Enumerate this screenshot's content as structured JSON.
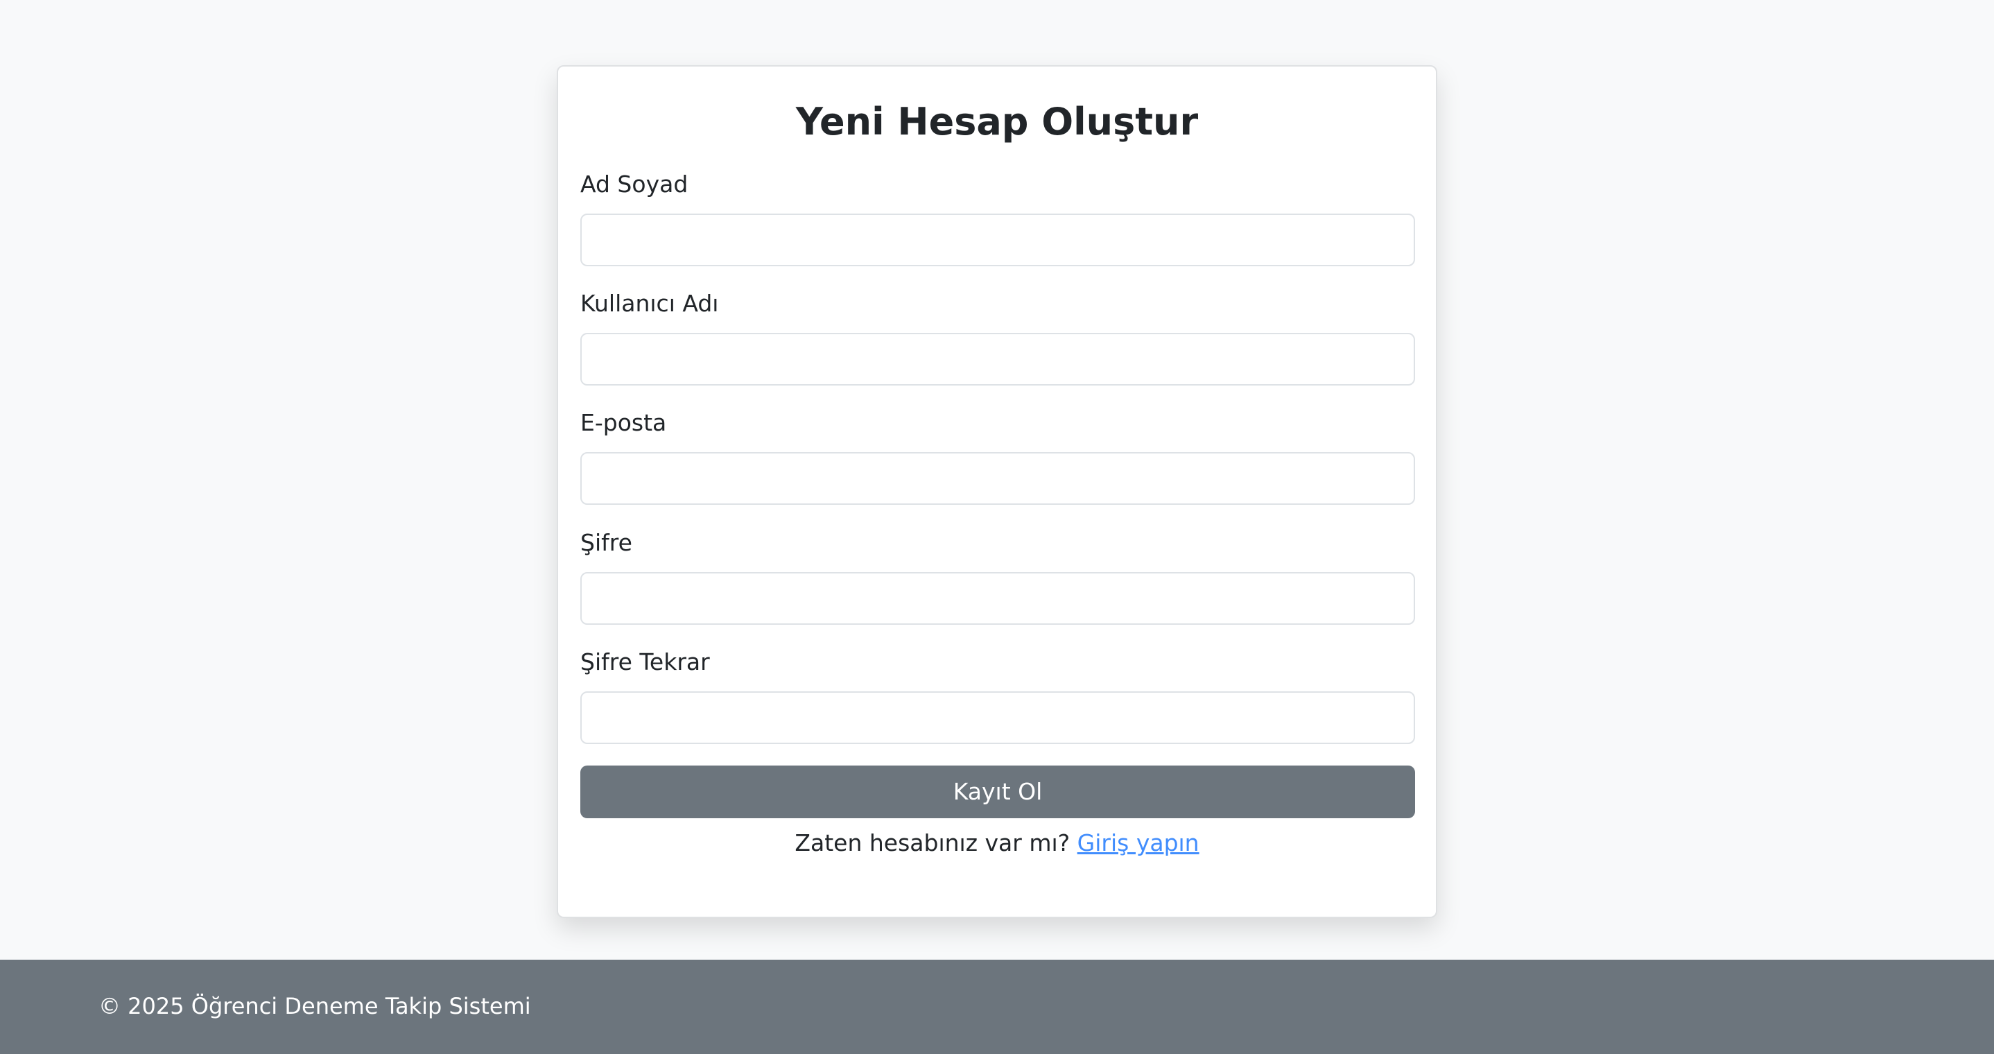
{
  "form": {
    "title": "Yeni Hesap Oluştur",
    "fields": [
      {
        "label": "Ad Soyad",
        "value": "",
        "placeholder": ""
      },
      {
        "label": "Kullanıcı Adı",
        "value": "",
        "placeholder": ""
      },
      {
        "label": "E-posta",
        "value": "",
        "placeholder": ""
      },
      {
        "label": "Şifre",
        "value": "",
        "placeholder": ""
      },
      {
        "label": "Şifre Tekrar",
        "value": "",
        "placeholder": ""
      }
    ],
    "submit_label": "Kayıt Ol",
    "login_prompt": "Zaten hesabınız var mı?",
    "login_link": "Giriş yapın"
  },
  "footer": {
    "text": "© 2025 Öğrenci Deneme Takip Sistemi"
  },
  "colors": {
    "page_background": "#f8f9fa",
    "button_background": "#6c757d",
    "footer_background": "#6c757d",
    "link": "#0d6efd"
  }
}
